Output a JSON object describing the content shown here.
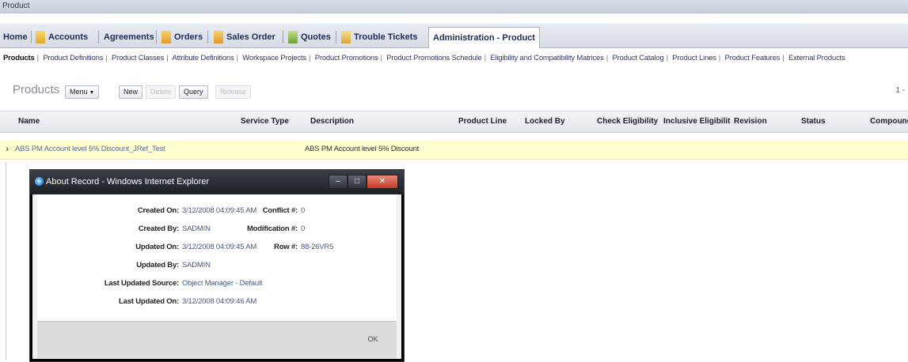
{
  "window": {
    "title": "Product"
  },
  "tabs": [
    {
      "label": "Home"
    },
    {
      "label": "Accounts"
    },
    {
      "label": "Agreements"
    },
    {
      "label": "Orders"
    },
    {
      "label": "Sales Order"
    },
    {
      "label": "Quotes"
    },
    {
      "label": "Trouble Tickets"
    },
    {
      "label": "Administration - Product"
    }
  ],
  "subtabs": [
    "Products",
    "Product Definitions",
    "Product Classes",
    "Attribute Definitions",
    "Workspace Projects",
    "Product Promotions",
    "Product Promotions Schedule",
    "Eligibility and Compatibility Matrices",
    "Product Catalog",
    "Product Lines",
    "Product Features",
    "External Products"
  ],
  "applet": {
    "title": "Products",
    "menu_label": "Menu",
    "new_label": "New",
    "delete_label": "Delete",
    "query_label": "Query",
    "release_label": "Release",
    "pager": "1 -"
  },
  "grid": {
    "columns": [
      "Name",
      "Service Type",
      "Description",
      "Product Line",
      "Locked By",
      "Check Eligibility",
      "Inclusive Eligibilit",
      "Revision",
      "Status",
      "Compound"
    ],
    "rows": [
      {
        "name": "ABS PM Account level 5% Discount_JRef_Test",
        "service_type": "",
        "description": "ABS PM Account level 5% Discount"
      }
    ]
  },
  "dialog": {
    "title": "About Record - Windows Internet Explorer",
    "created_on_label": "Created On:",
    "created_on": "3/12/2008 04:09:45 AM",
    "created_by_label": "Created By:",
    "created_by": "SADMIN",
    "updated_on_label": "Updated On:",
    "updated_on": "3/12/2008 04:09:45 AM",
    "updated_by_label": "Updated By:",
    "updated_by": "SADMIN",
    "last_updated_source_label": "Last Updated Source:",
    "last_updated_source": "Object Manager - Default",
    "last_updated_on_label": "Last Updated On:",
    "last_updated_on": "3/12/2008 04:09:46 AM",
    "conflict_label": "Conflict #:",
    "conflict": "0",
    "modification_label": "Modification #:",
    "modification": "0",
    "row_label": "Row #:",
    "row": "88-26VR5",
    "ok_label": "OK"
  },
  "colors": {
    "tab_text": "#1b2c5a",
    "row_highlight": "#ffffcf",
    "dialog_title_bg": "#1c1f25",
    "close_button": "#c43a23"
  }
}
